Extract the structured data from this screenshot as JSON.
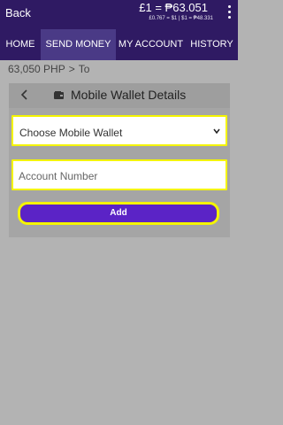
{
  "header": {
    "back_label": "Back",
    "rate_main": "£1 = ₱63.051",
    "rate_sub": "£0.767 = $1  |  $1 = ₱48.331",
    "menu_icon": "kebab-menu-icon"
  },
  "nav": {
    "tabs": [
      {
        "label": "HOME"
      },
      {
        "label": "SEND MONEY"
      },
      {
        "label": "MY ACCOUNT"
      },
      {
        "label": "HISTORY"
      }
    ],
    "active_index": 1
  },
  "breadcrumb": {
    "amount": "63,050 PHP",
    "separator": ">",
    "step": "To"
  },
  "panel": {
    "back_icon": "chevron-left-icon",
    "title_icon": "wallet-icon",
    "title": "Mobile Wallet Details",
    "wallet_select": {
      "selected": "Choose Mobile Wallet"
    },
    "account_number": {
      "value": "",
      "placeholder": "Account Number"
    },
    "add_label": "Add"
  },
  "colors": {
    "header_bg": "#2f1a63",
    "active_tab_bg": "#4a3a86",
    "highlight": "#f4f400",
    "button": "#5b23c6",
    "page_bg": "#b3b3b3"
  }
}
